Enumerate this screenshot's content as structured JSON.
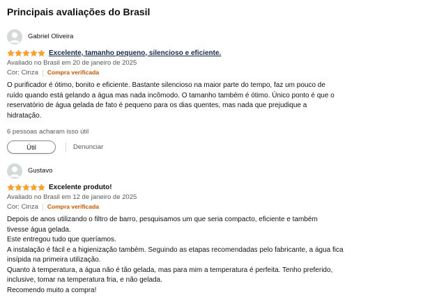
{
  "section": {
    "title": "Principais avaliações do Brasil"
  },
  "colors": {
    "star": "#ffa41c",
    "verified": "#c45500",
    "link_title": "#162a4a",
    "secondary_text": "#565959"
  },
  "reviews": [
    {
      "reviewer": "Gabriel Oliveira",
      "rating": 5,
      "rating_max": 5,
      "title": "Excelente, tamanho pequeno, silencioso e eficiente.",
      "meta": "Avaliado no Brasil em 20 de janeiro de 2025",
      "variant": "Cor: Cinza",
      "verified": "Compra verificada",
      "body_lines": [
        "O purificador é ótimo, bonito e eficiente. Bastante silencioso na maior parte do tempo, faz um pouco de",
        "ruído quando está gelando a água mas nada incômodo. O tamanho também é ótimo. Único ponto é que o",
        "reservatório de água gelada de fato é pequeno para os dias quentes, mas nada que prejudique a",
        "hidratação."
      ],
      "helpful": "6 pessoas acharam isso útil",
      "helpful_button": "Útil",
      "report": "Denunciar"
    },
    {
      "reviewer": "Gustavo",
      "rating": 5,
      "rating_max": 5,
      "title": "Excelente produto!",
      "meta": "Avaliado no Brasil em 12 de janeiro de 2025",
      "variant": "Cor: Cinza",
      "verified": "Compra verificada",
      "body_lines": [
        "Depois de anos utilizando o filtro de barro, pesquisamos um que seria compacto, eficiente e também",
        "tivesse água gelada.",
        "Este entregou tudo que queríamos.",
        "A instalação é fácil e a higienização também. Seguindo as etapas recomendadas pelo fabricante, a água fica",
        "insípida na primeira utilização.",
        "Quanto à temperatura, a água não é tão gelada, mas para mim a temperatura é perfeita. Tenho preferido,",
        "inclusive, tomar na temperatura fria, e não gelada.",
        "Recomendo muito a compra!"
      ]
    }
  ]
}
